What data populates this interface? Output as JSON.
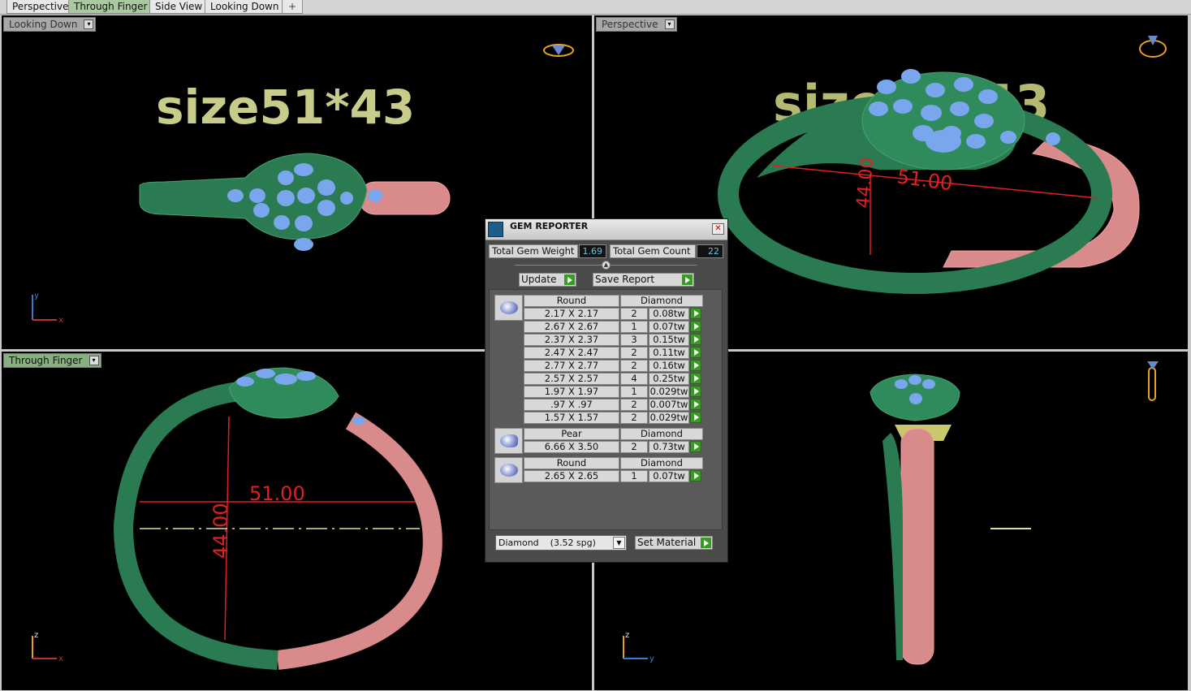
{
  "tabs": [
    {
      "label": "Perspective",
      "active": false
    },
    {
      "label": "Through Finger",
      "active": true
    },
    {
      "label": "Side View",
      "active": false
    },
    {
      "label": "Looking Down",
      "active": false
    }
  ],
  "tab_add_icon": "plus-icon",
  "viewports": {
    "top_left": {
      "label": "Looking Down",
      "overlay_text": "size51*43",
      "axes": [
        "y",
        "x"
      ]
    },
    "top_right": {
      "label": "Perspective",
      "overlay_text": "size51*43",
      "dimension": "51.00",
      "dimension2": "44.00"
    },
    "bottom_left": {
      "label": "Through Finger",
      "dimension_h": "51.00",
      "dimension_v": "44.00",
      "axes": [
        "z",
        "x"
      ]
    },
    "bottom_right": {
      "axes": [
        "z",
        "y"
      ]
    }
  },
  "gem_reporter": {
    "title": "GEM REPORTER",
    "total_weight_label": "Total Gem Weight",
    "total_weight_value": "1.69",
    "total_count_label": "Total Gem Count",
    "total_count_value": "22",
    "update_label": "Update",
    "save_report_label": "Save Report",
    "groups": [
      {
        "shape": "Round",
        "material": "Diamond",
        "rows": [
          {
            "size": "2.17 X 2.17",
            "count": "2",
            "weight": "0.08tw"
          },
          {
            "size": "2.67 X 2.67",
            "count": "1",
            "weight": "0.07tw"
          },
          {
            "size": "2.37 X 2.37",
            "count": "3",
            "weight": "0.15tw"
          },
          {
            "size": "2.47 X 2.47",
            "count": "2",
            "weight": "0.11tw"
          },
          {
            "size": "2.77 X 2.77",
            "count": "2",
            "weight": "0.16tw"
          },
          {
            "size": "2.57 X 2.57",
            "count": "4",
            "weight": "0.25tw"
          },
          {
            "size": "1.97 X 1.97",
            "count": "1",
            "weight": "0.029tw"
          },
          {
            "size": ".97 X .97",
            "count": "2",
            "weight": "0.007tw"
          },
          {
            "size": "1.57 X 1.57",
            "count": "2",
            "weight": "0.029tw"
          }
        ]
      },
      {
        "shape": "Pear",
        "material": "Diamond",
        "rows": [
          {
            "size": "6.66 X 3.50",
            "count": "2",
            "weight": "0.73tw"
          }
        ]
      },
      {
        "shape": "Round",
        "material": "Diamond",
        "rows": [
          {
            "size": "2.65 X 2.65",
            "count": "1",
            "weight": "0.07tw"
          }
        ]
      }
    ],
    "material_select": "Diamond    (3.52 spg)",
    "set_material_label": "Set Material"
  },
  "colors": {
    "ring_green": "#2a7a52",
    "ring_pink": "#d98a8a",
    "gem_blue": "#7aa6ee",
    "text_olive": "#c8cc8a",
    "dim_red": "#e02020",
    "accent_green": "#3a9a28"
  }
}
